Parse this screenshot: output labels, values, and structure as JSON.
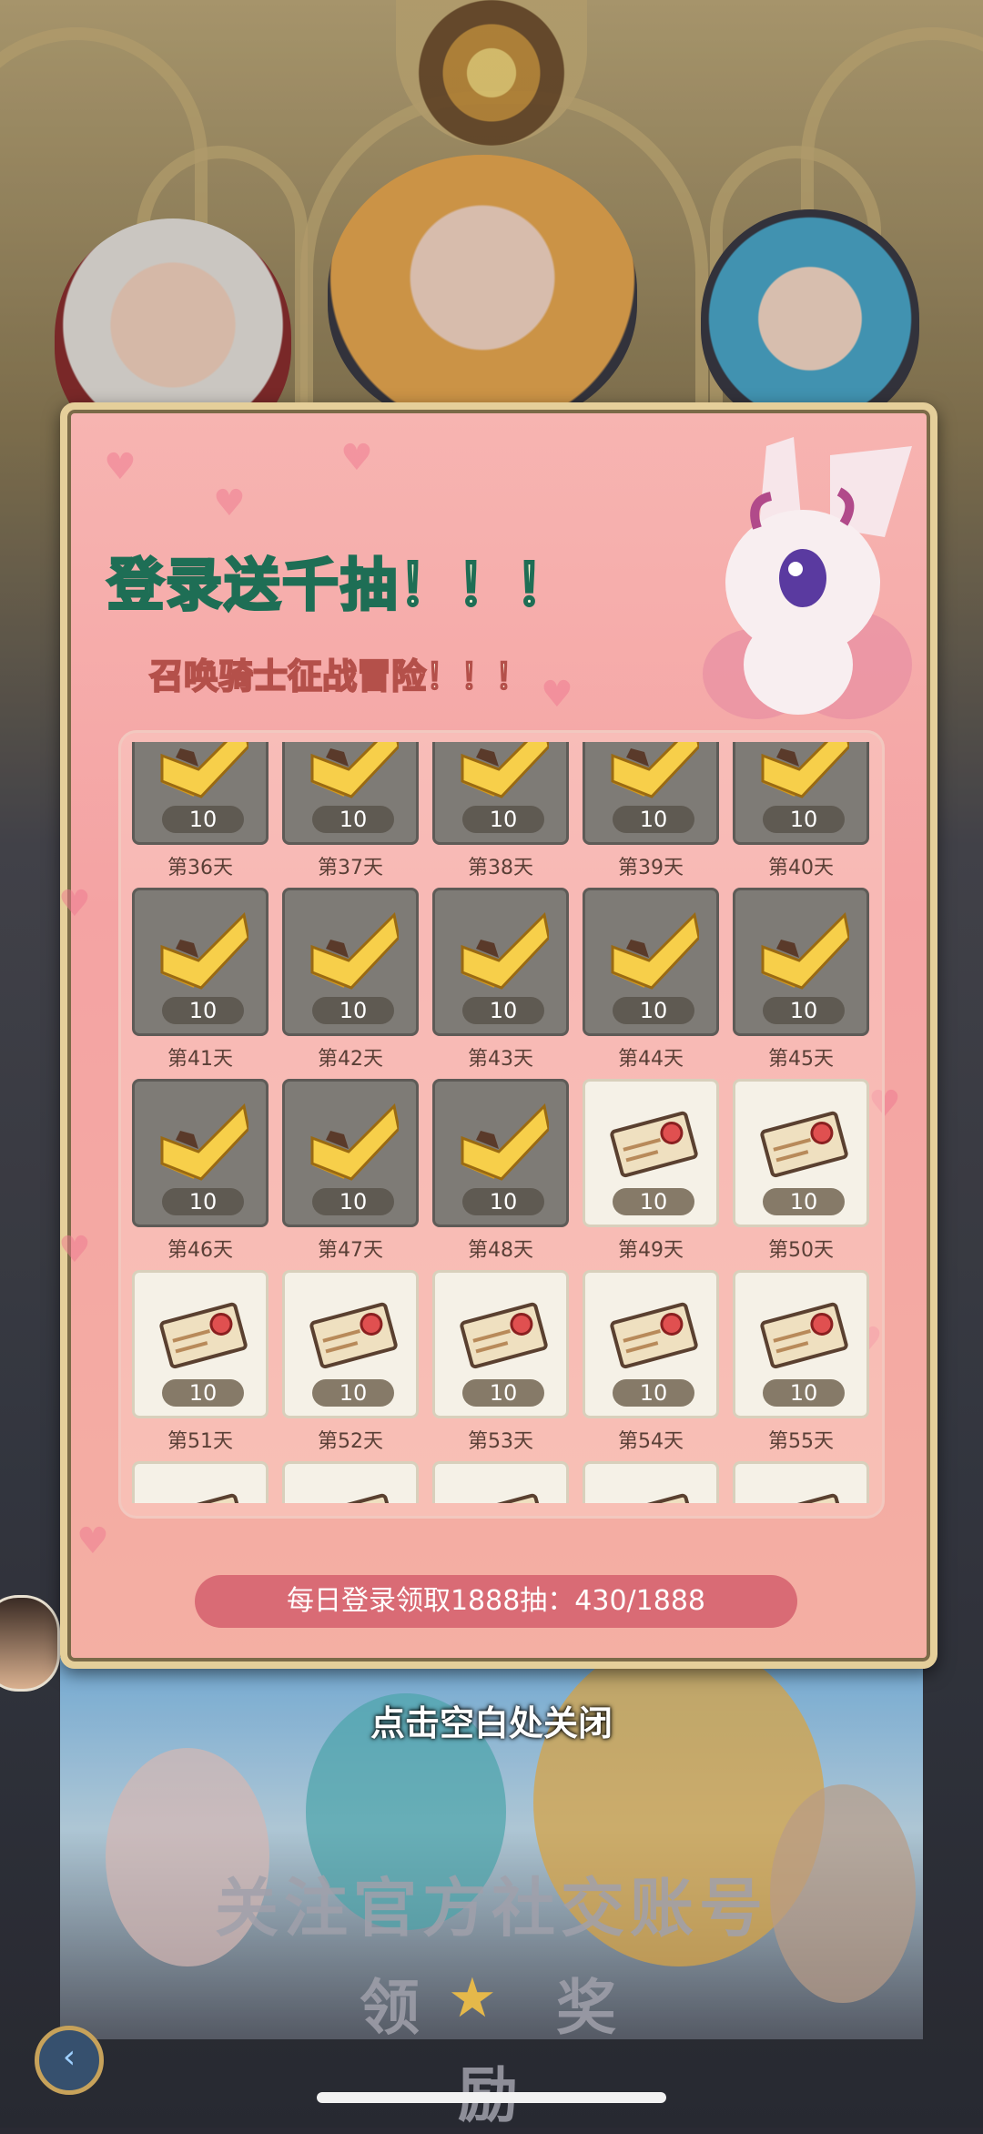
{
  "popup": {
    "title": "登录送千抽！！！",
    "subtitle": "召唤骑士征战冒险！！！",
    "progress_text": "每日登录领取1888抽：430/1888"
  },
  "rewards": [
    {
      "day": "第36天",
      "amount": "10",
      "claimed": true
    },
    {
      "day": "第37天",
      "amount": "10",
      "claimed": true
    },
    {
      "day": "第38天",
      "amount": "10",
      "claimed": true
    },
    {
      "day": "第39天",
      "amount": "10",
      "claimed": true
    },
    {
      "day": "第40天",
      "amount": "10",
      "claimed": true
    },
    {
      "day": "第41天",
      "amount": "10",
      "claimed": true
    },
    {
      "day": "第42天",
      "amount": "10",
      "claimed": true
    },
    {
      "day": "第43天",
      "amount": "10",
      "claimed": true
    },
    {
      "day": "第44天",
      "amount": "10",
      "claimed": true
    },
    {
      "day": "第45天",
      "amount": "10",
      "claimed": true
    },
    {
      "day": "第46天",
      "amount": "10",
      "claimed": true
    },
    {
      "day": "第47天",
      "amount": "10",
      "claimed": true
    },
    {
      "day": "第48天",
      "amount": "10",
      "claimed": true
    },
    {
      "day": "第49天",
      "amount": "10",
      "claimed": false
    },
    {
      "day": "第50天",
      "amount": "10",
      "claimed": false
    },
    {
      "day": "第51天",
      "amount": "10",
      "claimed": false
    },
    {
      "day": "第52天",
      "amount": "10",
      "claimed": false
    },
    {
      "day": "第53天",
      "amount": "10",
      "claimed": false
    },
    {
      "day": "第54天",
      "amount": "10",
      "claimed": false
    },
    {
      "day": "第55天",
      "amount": "10",
      "claimed": false
    },
    {
      "day": "",
      "amount": "",
      "claimed": false
    },
    {
      "day": "",
      "amount": "",
      "claimed": false
    },
    {
      "day": "",
      "amount": "",
      "claimed": false
    },
    {
      "day": "",
      "amount": "",
      "claimed": false
    },
    {
      "day": "",
      "amount": "",
      "claimed": false
    }
  ],
  "close_hint": "点击空白处关闭",
  "banner": {
    "line1": "关注官方社交账号",
    "line2_left": "领",
    "line2_right": "奖励"
  },
  "icons": {
    "claimed": "gold-check-icon",
    "unclaimed": "summon-ticket-icon",
    "back": "back-arrow-icon"
  },
  "colors": {
    "panel_pink": "#f4a3a3",
    "claimed_tile": "#7e7b76",
    "unclaimed_tile": "#f5f1e7",
    "title_stroke": "#1e6e55"
  }
}
